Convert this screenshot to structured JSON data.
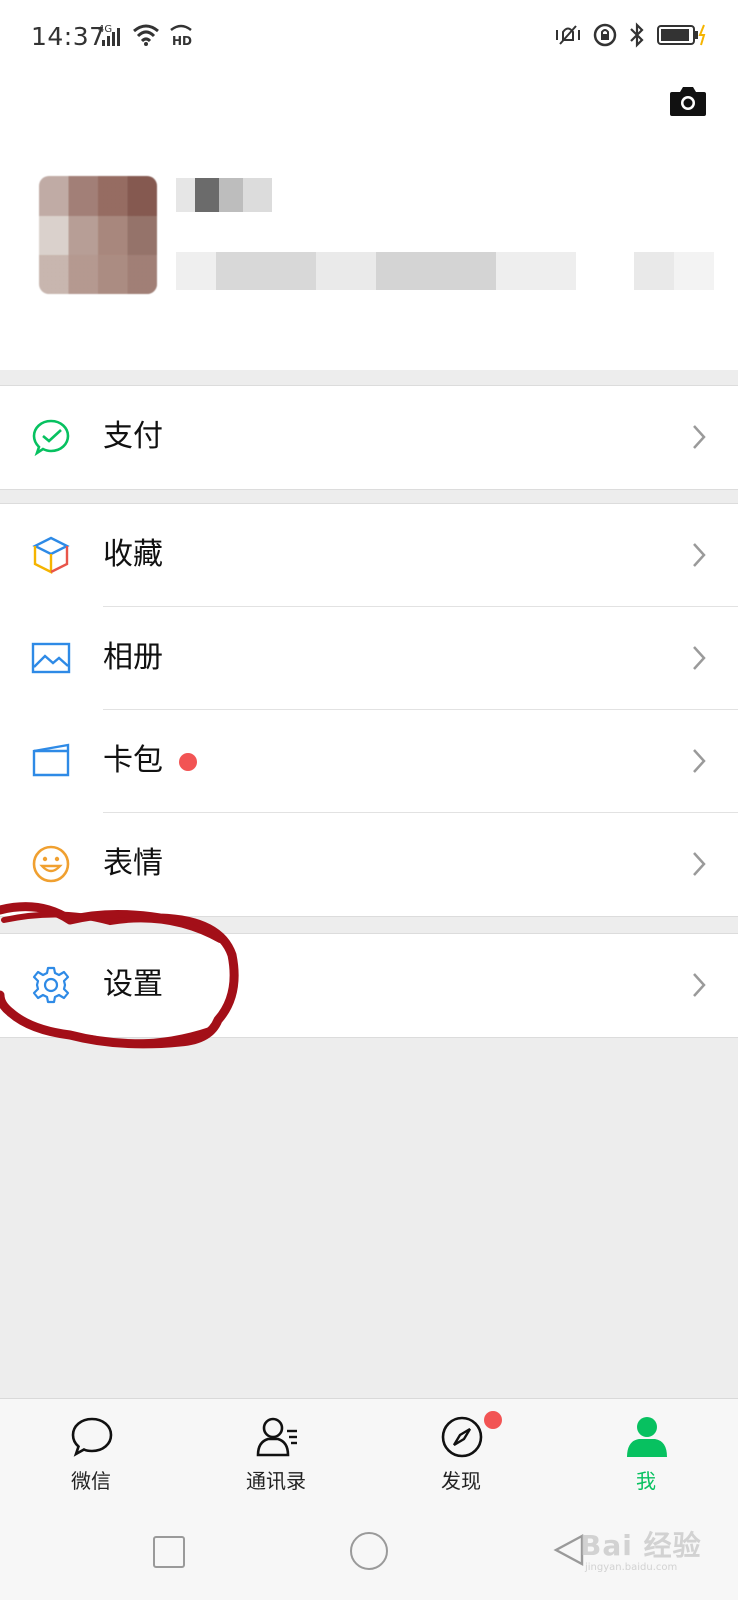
{
  "status_bar": {
    "time": "14:37",
    "network": "4G",
    "hd": "HD"
  },
  "profile": {
    "name": "",
    "wechat_id": ""
  },
  "menu": {
    "pay": "支付",
    "favorites": "收藏",
    "album": "相册",
    "wallet": "卡包",
    "stickers": "表情",
    "settings": "设置"
  },
  "tabbar": {
    "chats": "微信",
    "contacts": "通讯录",
    "discover": "发现",
    "me": "我"
  },
  "watermark": {
    "main": "Bai 经验",
    "sub": "jingyan.baidu.com"
  },
  "colors": {
    "accent_green": "#07c160",
    "badge_red": "#f25454",
    "annotation_red": "#a30f18"
  }
}
